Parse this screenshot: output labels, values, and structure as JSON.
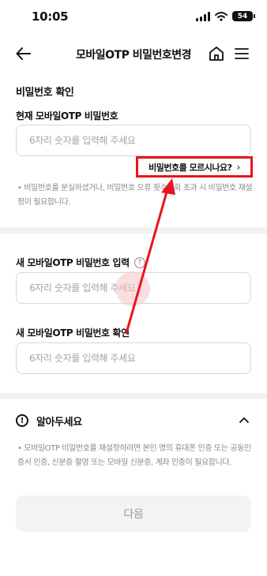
{
  "status_bar": {
    "time": "10:05",
    "battery": "54"
  },
  "header": {
    "title": "모바일OTP 비밀번호변경"
  },
  "current_section": {
    "title": "비밀번호 확인",
    "field_label": "현재 모바일OTP 비밀번호",
    "placeholder": "6자리 숫자를 입력해 주세요",
    "forgot_label": "비밀번호를 모르시나요?",
    "note": "• 비밀번호를 분실하셨거나, 비밀번호 오류 횟수 5회 초과 시 비밀번호 재설정이 필요합니다."
  },
  "new_section": {
    "new_label": "새 모바일OTP 비밀번호 입력",
    "new_placeholder": "6자리 숫자를 입력해 주세요",
    "confirm_label": "새 모바일OTP 비밀번호 확인",
    "confirm_placeholder": "6자리 숫자를 입력해 주세요"
  },
  "notice": {
    "title": "알아두세요",
    "text": "• 모바일OTP 비밀번호를 재설정하려면 본인 명의 휴대폰 인증 또는 공동인증서 인증, 신분증 촬영 또는 모바일 신분증, 계좌 인증이 필요합니다."
  },
  "next_button": "다음",
  "accent_color": "#e8141e"
}
